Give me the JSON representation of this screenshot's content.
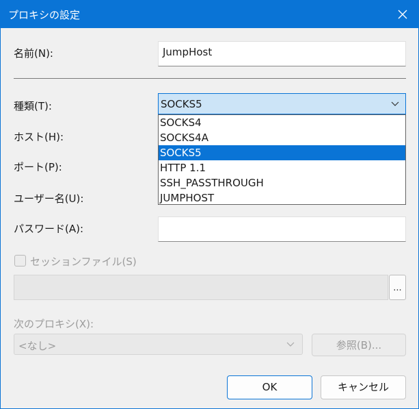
{
  "window": {
    "title": "プロキシの設定",
    "accent": "#0a74d6"
  },
  "form": {
    "name_label": "名前(N):",
    "name_value": "JumpHost",
    "type_label": "種類(T):",
    "type_selected": "SOCKS5",
    "type_options": [
      "SOCKS4",
      "SOCKS4A",
      "SOCKS5",
      "HTTP 1.1",
      "SSH_PASSTHROUGH",
      "JUMPHOST"
    ],
    "host_label": "ホスト(H):",
    "port_label": "ポート(P):",
    "user_label": "ユーザー名(U):",
    "password_label": "パスワード(A):",
    "session_file_label": "セッションファイル(S)",
    "browse_small_label": "...",
    "next_proxy_label": "次のプロキシ(X):",
    "next_proxy_value": "<なし>",
    "browse_label": "参照(B)..."
  },
  "buttons": {
    "ok": "OK",
    "cancel": "キャンセル"
  }
}
